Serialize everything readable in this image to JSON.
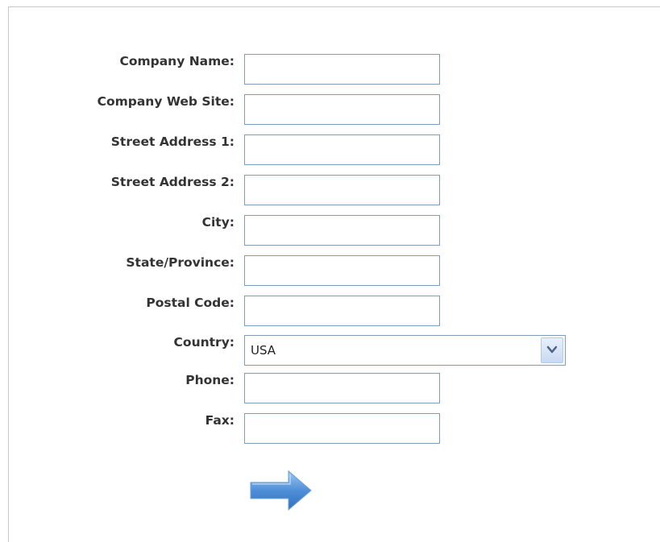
{
  "form": {
    "fields": [
      {
        "id": "company-name",
        "label": "Company Name:",
        "value": ""
      },
      {
        "id": "company-web-site",
        "label": "Company Web Site:",
        "value": ""
      },
      {
        "id": "street-address-1",
        "label": "Street Address 1:",
        "value": ""
      },
      {
        "id": "street-address-2",
        "label": "Street Address 2:",
        "value": ""
      },
      {
        "id": "city",
        "label": "City:",
        "value": ""
      },
      {
        "id": "state-province",
        "label": "State/Province:",
        "value": ""
      },
      {
        "id": "postal-code",
        "label": "Postal Code:",
        "value": ""
      },
      {
        "id": "country",
        "label": "Country:",
        "value": "USA"
      },
      {
        "id": "phone",
        "label": "Phone:",
        "value": ""
      },
      {
        "id": "fax",
        "label": "Fax:",
        "value": ""
      }
    ],
    "submit_icon": "arrow-right-icon",
    "colors": {
      "label_text": "#333333",
      "input_border": "#7f9db9",
      "arrow_fill": "#4f8fd8",
      "frame_border": "#c8c8c8"
    }
  }
}
